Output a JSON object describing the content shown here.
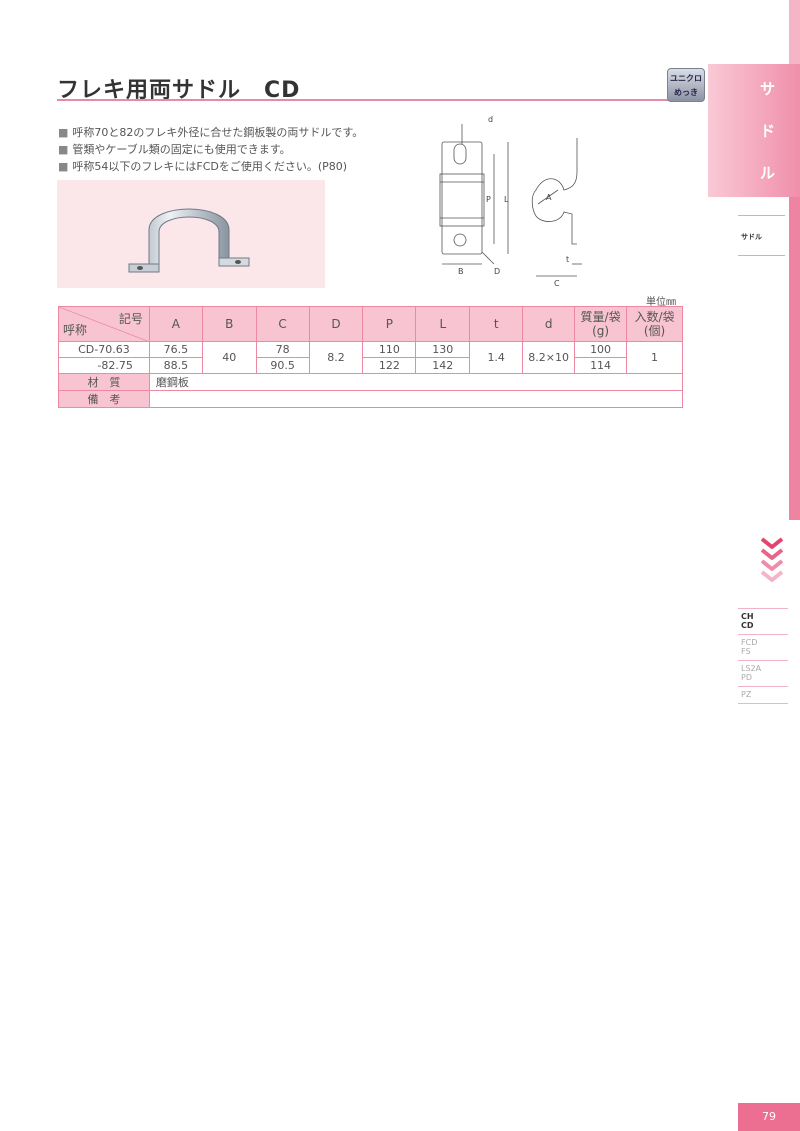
{
  "header": {
    "title": "フレキ用両サドル　CD",
    "badge_line1": "ユニクロ",
    "badge_line2": "めっき"
  },
  "bullets": [
    "呼称70と82のフレキ外径に合せた鋼板製の両サドルです。",
    "管類やケーブル類の固定にも使用できます。",
    "呼称54以下のフレキにはFCDをご使用ください。(P80)"
  ],
  "bullet_mark": "■",
  "drawing": {
    "labels": {
      "d": "d",
      "P": "P",
      "L": "L",
      "B": "B",
      "D": "D",
      "C": "C",
      "t": "t",
      "A": "A"
    }
  },
  "side": {
    "tab_chars": [
      "サ",
      "ド",
      "ル"
    ],
    "category": "サドル",
    "nav": [
      "CH",
      "CD",
      "FCD",
      "FS",
      "LS2A",
      "PD",
      "PZ"
    ]
  },
  "table": {
    "unit": "単位㎜",
    "corner_top": "記号",
    "corner_bottom": "呼称",
    "columns": [
      "A",
      "B",
      "C",
      "D",
      "P",
      "L",
      "t",
      "d",
      "質量/袋",
      "(g)",
      "入数/袋",
      "(個)"
    ],
    "rows": [
      {
        "name": "CD-70.63",
        "A": "76.5",
        "C": "78",
        "P": "110",
        "L": "130",
        "mass": "100"
      },
      {
        "name": "-82.75",
        "A": "88.5",
        "C": "90.5",
        "P": "122",
        "L": "142",
        "mass": "114"
      }
    ],
    "shared": {
      "B": "40",
      "D": "8.2",
      "t": "1.4",
      "d": "8.2×10",
      "qty": "1"
    },
    "material_label": "材　質",
    "material_value": "磨鋼板",
    "remarks_label": "備　考",
    "remarks_value": ""
  },
  "page": {
    "number": "79"
  },
  "colors": {
    "accent": "#ec6f92",
    "header_fill": "#f8c4d2",
    "rule": "#e88aa4"
  }
}
